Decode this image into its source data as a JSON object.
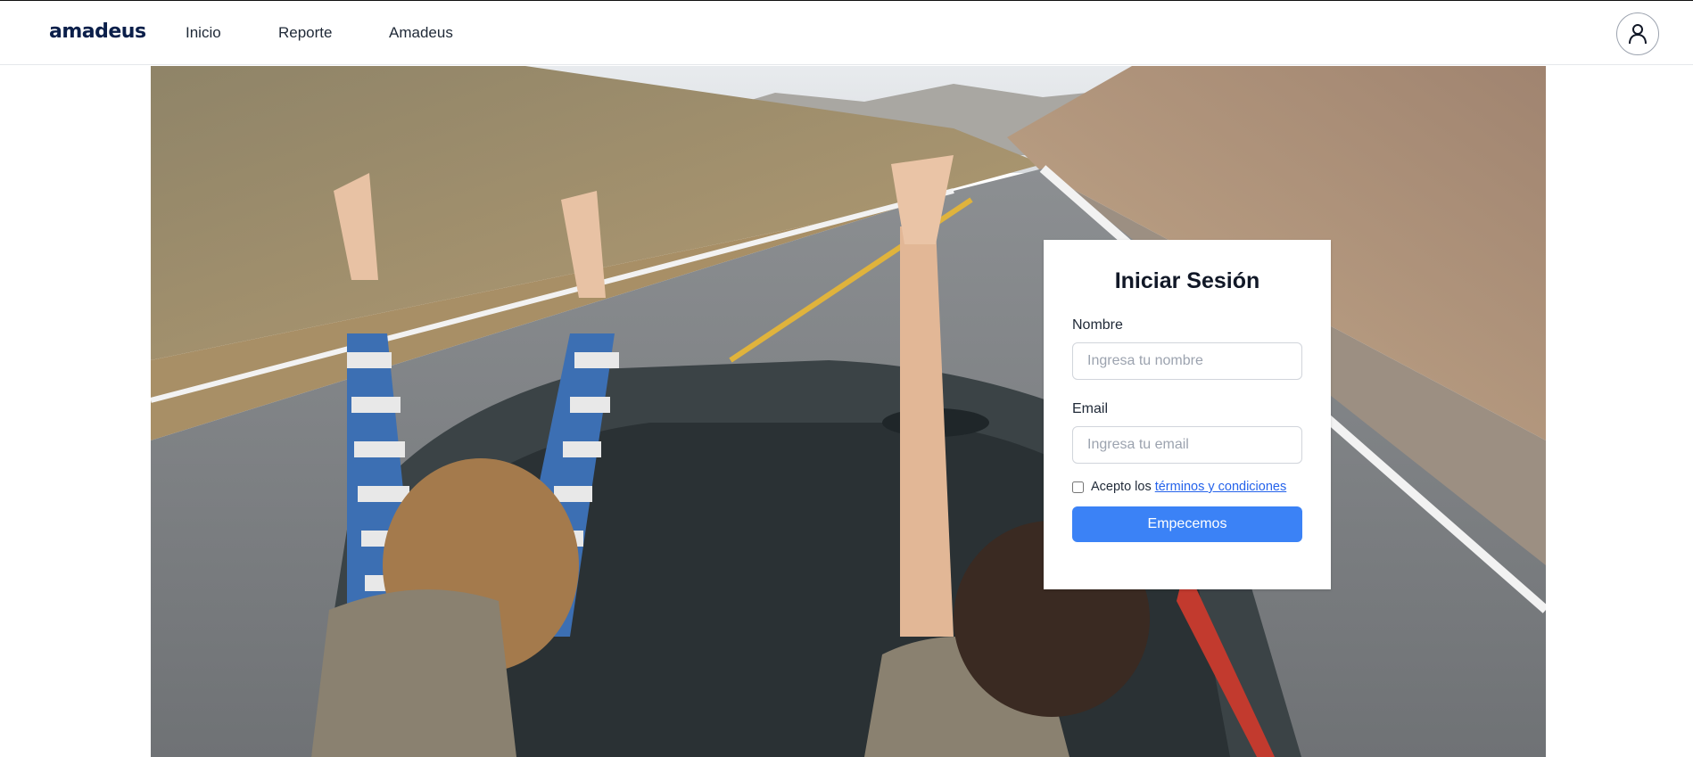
{
  "header": {
    "logo": "amadeus",
    "nav": [
      {
        "label": "Inicio"
      },
      {
        "label": "Reporte"
      },
      {
        "label": "Amadeus"
      }
    ],
    "avatar_icon": "user-icon"
  },
  "hero": {
    "image": "photo-two-people-convertible-road-peace-signs"
  },
  "login": {
    "title": "Iniciar Sesión",
    "name_label": "Nombre",
    "name_placeholder": "Ingresa tu nombre",
    "email_label": "Email",
    "email_placeholder": "Ingresa tu email",
    "terms_prefix": "Acepto los",
    "terms_link": "términos y condiciones",
    "submit_label": "Empecemos"
  },
  "colors": {
    "accent": "#3b82f6",
    "link": "#2563eb",
    "logo": "#0b1f4a"
  }
}
